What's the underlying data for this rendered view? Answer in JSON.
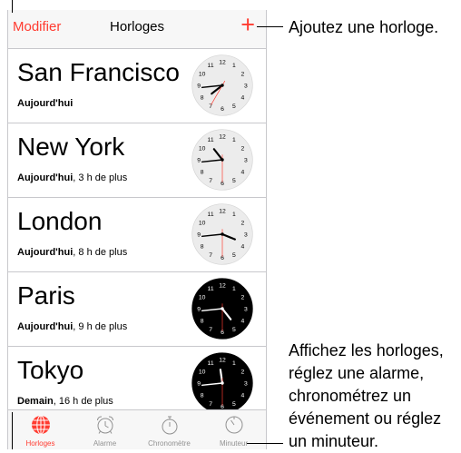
{
  "navbar": {
    "edit_label": "Modifier",
    "title": "Horloges",
    "add_label": "+"
  },
  "clocks": [
    {
      "city": "San Francisco",
      "day": "Aujourd'hui",
      "offset": "",
      "hour": 7,
      "minute": 44,
      "second": 35,
      "face": "light"
    },
    {
      "city": "New York",
      "day": "Aujourd'hui",
      "offset": ", 3 h de plus",
      "hour": 10,
      "minute": 44,
      "second": 30,
      "face": "light"
    },
    {
      "city": "London",
      "day": "Aujourd'hui",
      "offset": ", 8 h de plus",
      "hour": 3,
      "minute": 44,
      "second": 30,
      "face": "light"
    },
    {
      "city": "Paris",
      "day": "Aujourd'hui",
      "offset": ", 9 h de plus",
      "hour": 4,
      "minute": 44,
      "second": 30,
      "face": "dark"
    },
    {
      "city": "Tokyo",
      "day": "Demain",
      "offset": ", 16 h de plus",
      "hour": 11,
      "minute": 44,
      "second": 30,
      "face": "dark"
    }
  ],
  "tabs": [
    {
      "label": "Horloges",
      "icon": "globe-icon",
      "active": true
    },
    {
      "label": "Alarme",
      "icon": "alarm-clock-icon",
      "active": false
    },
    {
      "label": "Chronomètre",
      "icon": "stopwatch-icon",
      "active": false
    },
    {
      "label": "Minuteur",
      "icon": "timer-icon",
      "active": false
    }
  ],
  "callouts": {
    "add_clock": "Ajoutez une horloge.",
    "tabs_info": [
      "Affichez les horloges,",
      "réglez une alarme,",
      "chronométrez un",
      "événement ou réglez",
      "un minuteur."
    ]
  },
  "colors": {
    "accent": "#ff3b30",
    "light_face": "#ececec",
    "dark_face": "#000000"
  }
}
